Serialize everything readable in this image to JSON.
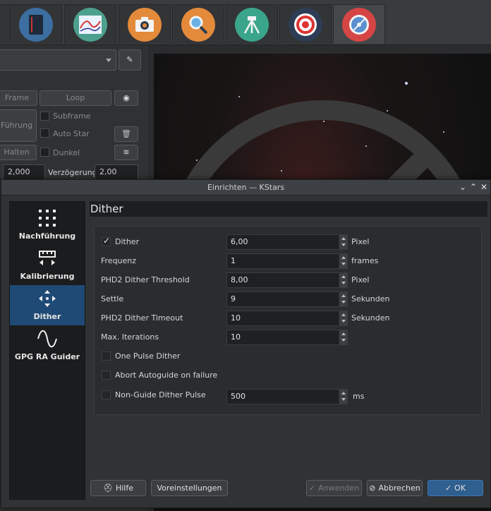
{
  "background": {
    "left_panel": {
      "btn_frame": "Frame",
      "btn_loop": "Loop",
      "btn_guide": "Führung",
      "chk_subframe": "Subframe",
      "chk_autostar": "Auto Star",
      "chk_dark": "Dunkel",
      "btn_halten": "Halten",
      "spin_exposure": "2,000",
      "delay_label": "Verzögerung:",
      "spin_delay": "2,00"
    }
  },
  "dialog": {
    "title": "Einrichten — KStars",
    "sidebar": [
      {
        "label": "Nachführung",
        "icon": "dots-grid-icon"
      },
      {
        "label": "Kalibrierung",
        "icon": "ruler-icon"
      },
      {
        "label": "Dither",
        "icon": "move-arrows-icon"
      },
      {
        "label": "GPG RA Guider",
        "icon": "sine-wave-icon"
      }
    ],
    "page_title": "Dither",
    "fields": [
      {
        "label": "Dither",
        "value": "6,00",
        "unit": "Pixel",
        "checkbox": true,
        "checked": true
      },
      {
        "label": "Frequenz",
        "value": "1",
        "unit": "frames"
      },
      {
        "label": "PHD2 Dither Threshold",
        "value": "8,00",
        "unit": "Pixel"
      },
      {
        "label": "Settle",
        "value": "9",
        "unit": "Sekunden"
      },
      {
        "label": "PHD2 Dither Timeout",
        "value": "10",
        "unit": "Sekunden"
      },
      {
        "label": "Max. Iterations",
        "value": "10",
        "unit": ""
      }
    ],
    "checks": {
      "one_pulse": "One Pulse Dither",
      "abort_autoguide": "Abort Autoguide on failure",
      "non_guide_label": "Non-Guide Dither Pulse",
      "non_guide_value": "500",
      "non_guide_unit": "ms"
    },
    "footer": {
      "help": "Hilfe",
      "defaults": "Voreinstellungen",
      "apply": "Anwenden",
      "cancel": "Abbrechen",
      "ok": "OK"
    }
  }
}
